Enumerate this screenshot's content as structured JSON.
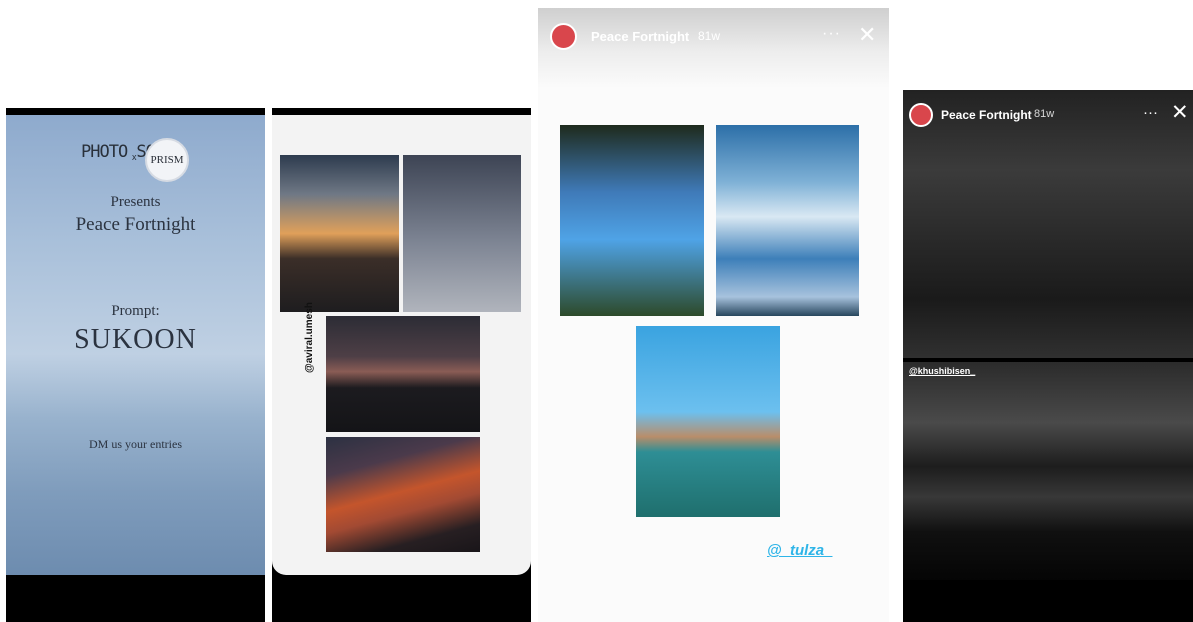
{
  "panel1": {
    "logo_left": "PHOTO SOC",
    "logo_x": "x",
    "logo_right": "PRISM",
    "presents": "Presents",
    "event": "Peace Fortnight",
    "prompt_label": "Prompt:",
    "prompt_word": "SUKOON",
    "cta": "DM us your entries"
  },
  "panel2": {
    "handle": "@aviral.umesh"
  },
  "panel3": {
    "account": "Peace Fortnight",
    "age": "81w",
    "more": "···",
    "close": "✕",
    "handle": "@_tulza_"
  },
  "panel4": {
    "account": "Peace Fortnight",
    "age": "81w",
    "more": "···",
    "close": "✕",
    "handle": "@khushibisen_"
  }
}
